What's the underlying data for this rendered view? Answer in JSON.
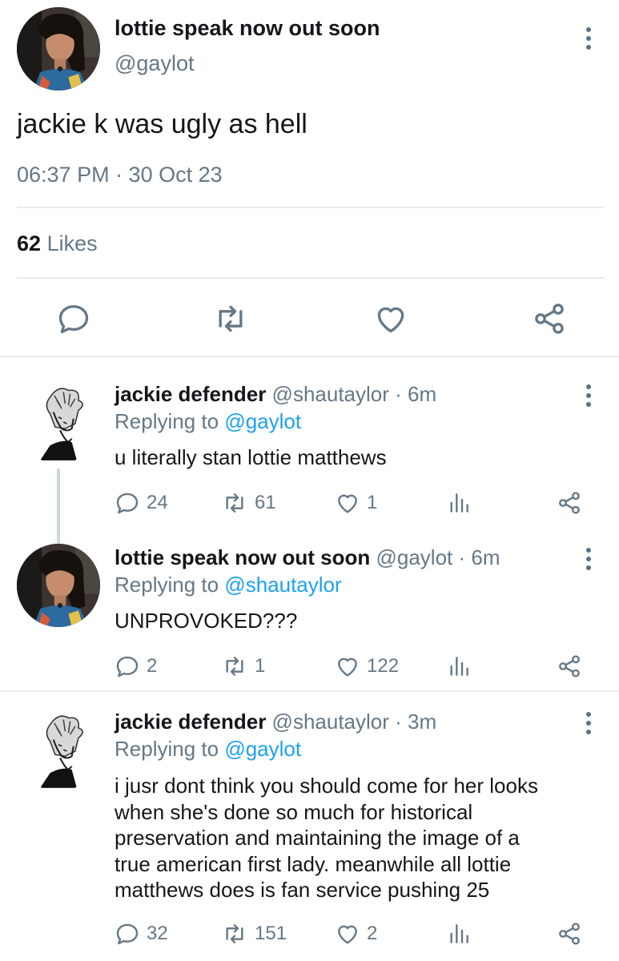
{
  "main_tweet": {
    "display_name": "lottie speak now out soon",
    "handle": "@gaylot",
    "text": "jackie k was ugly as hell",
    "timestamp": "06:37 PM · 30 Oct 23",
    "likes_count": "62",
    "likes_label": "Likes"
  },
  "replies": [
    {
      "display_name": "jackie defender",
      "handle_time": "@shautaylor · 6m",
      "replying_prefix": "Replying to",
      "replying_handle": "@gaylot",
      "text": "u literally stan lottie matthews",
      "comments": "24",
      "retweets": "61",
      "likes": "1"
    },
    {
      "display_name": "lottie speak now out soon",
      "handle_time": "@gaylot · 6m",
      "replying_prefix": "Replying to",
      "replying_handle": "@shautaylor",
      "text": "UNPROVOKED???",
      "comments": "2",
      "retweets": "1",
      "likes": "122"
    },
    {
      "display_name": "jackie defender",
      "handle_time": "@shautaylor · 3m",
      "replying_prefix": "Replying to",
      "replying_handle": "@gaylot",
      "text_lines": [
        "i jusr dont think you should come for her looks",
        "when she's done so much for historical",
        "preservation and maintaining the image of a",
        "true american first lady. meanwhile all lottie",
        "matthews does is fan service pushing 25"
      ],
      "comments": "32",
      "retweets": "151",
      "likes": "2"
    }
  ],
  "icons": {
    "more": "more-vertical-icon",
    "reply": "comment-icon",
    "retweet": "retweet-icon",
    "like": "heart-icon",
    "share": "share-icon",
    "analytics": "analytics-icon"
  },
  "colors": {
    "link_blue": "#1da1f2",
    "secondary_text": "#657786",
    "divider": "#e6ecf0"
  }
}
